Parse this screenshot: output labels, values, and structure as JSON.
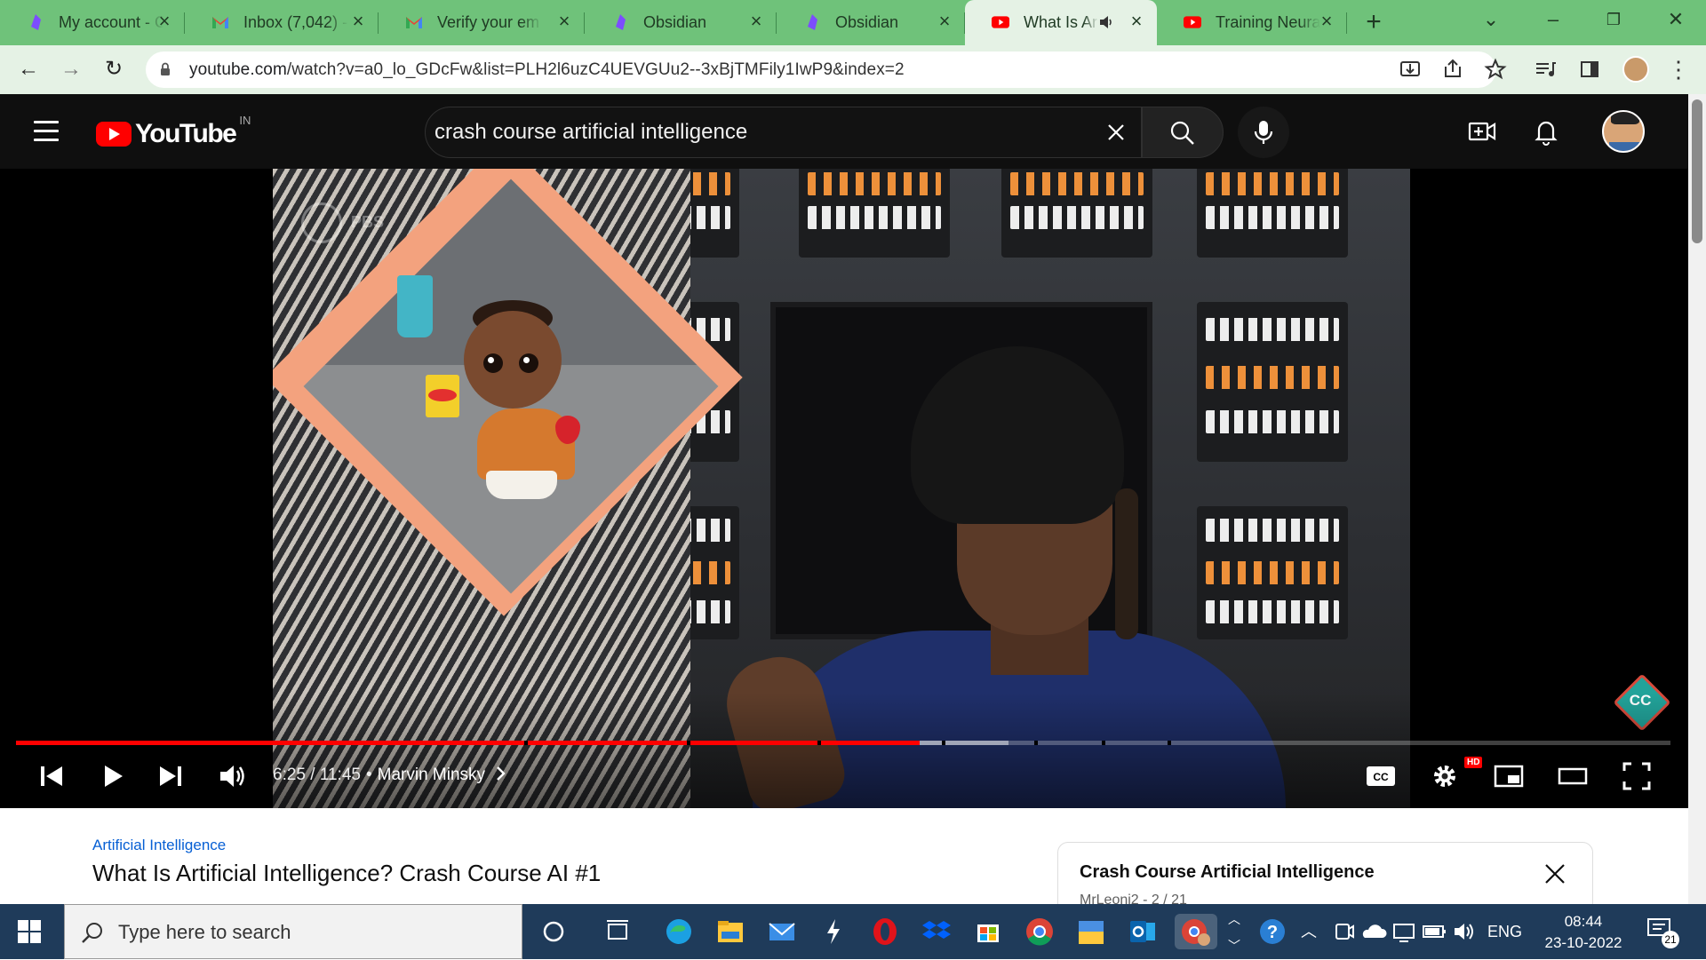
{
  "browser": {
    "tabs": [
      {
        "title": "My account - C",
        "icon": "obsidian-icon"
      },
      {
        "title": "Inbox (7,042) - ",
        "icon": "gmail-icon"
      },
      {
        "title": "Verify your em",
        "icon": "gmail-icon"
      },
      {
        "title": "Obsidian",
        "icon": "obsidian-icon"
      },
      {
        "title": "Obsidian",
        "icon": "obsidian-icon"
      },
      {
        "title": "What Is Ar",
        "icon": "youtube-icon",
        "active": true,
        "audio": true
      },
      {
        "title": "Training Neura",
        "icon": "youtube-icon"
      }
    ],
    "url_host": "youtube.com",
    "url_path": "/watch?v=a0_lo_GDcFw&list=PLH2l6uzC4UEVGUu2--3xBjTMFily1IwP9&index=2"
  },
  "youtube": {
    "logo_text": "YouTube",
    "region": "IN",
    "search_query": "crash course artificial intelligence"
  },
  "player": {
    "current_time": "6:25",
    "duration": "11:45",
    "chapter": "Marvin Minsky",
    "progress_fraction": 0.546,
    "buffered_fraction": 0.6,
    "hd_badge": "HD",
    "cc_label": "CC",
    "watermark": "PBS",
    "channel_badge": "CC",
    "colors": {
      "progress": "#ff0000",
      "accent": "#065fd4"
    }
  },
  "video_info": {
    "playlist_link": "Artificial Intelligence",
    "title": "What Is Artificial Intelligence? Crash Course AI #1"
  },
  "playlist_panel": {
    "title": "Crash Course Artificial Intelligence",
    "subtitle": "MrLeoni2 - 2 / 21"
  },
  "taskbar": {
    "search_placeholder": "Type here to search",
    "language": "ENG",
    "time": "08:44",
    "date": "23-10-2022",
    "notification_count": "21"
  }
}
